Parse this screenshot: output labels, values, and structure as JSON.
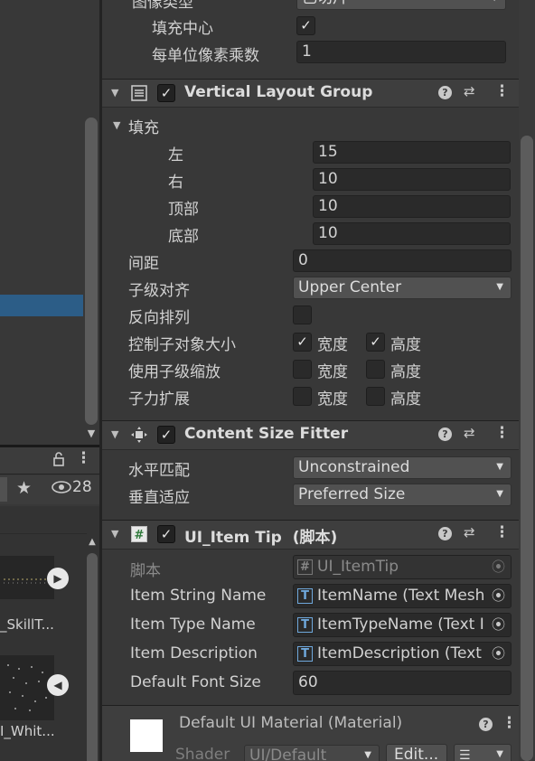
{
  "top_partial": {
    "image_type_label": "图像类型",
    "image_type_value": "已切片"
  },
  "image_section": {
    "fill_center_label": "填充中心",
    "fill_center_checked": true,
    "ppu_label": "每单位像素乘数",
    "ppu_value": "1"
  },
  "vlg": {
    "title": "Vertical Layout Group",
    "padding_label": "填充",
    "left_label": "左",
    "left_value": "15",
    "right_label": "右",
    "right_value": "10",
    "top_label": "顶部",
    "top_value": "10",
    "bottom_label": "底部",
    "bottom_value": "10",
    "spacing_label": "间距",
    "spacing_value": "0",
    "child_align_label": "子级对齐",
    "child_align_value": "Upper Center",
    "reverse_label": "反向排列",
    "control_size_label": "控制子对象大小",
    "use_scale_label": "使用子级缩放",
    "force_expand_label": "子力扩展",
    "width_label": "宽度",
    "height_label": "高度"
  },
  "csf": {
    "title": "Content Size Fitter",
    "horizontal_label": "水平匹配",
    "horizontal_value": "Unconstrained",
    "vertical_label": "垂直适应",
    "vertical_value": "Preferred Size"
  },
  "script": {
    "title": "UI_Item Tip",
    "suffix": "(脚本)",
    "script_label": "脚本",
    "script_value": "UI_ItemTip",
    "string_name_label": "Item String Name",
    "string_name_value": "ItemName (Text Mesh",
    "type_name_label": "Item Type Name",
    "type_name_value": "ItemTypeName (Text I",
    "desc_label": "Item Description",
    "desc_value": "ItemDescription (Text",
    "font_size_label": "Default Font Size",
    "font_size_value": "60"
  },
  "material": {
    "title": "Default UI Material (Material)",
    "shader_label": "Shader",
    "shader_value": "UI/Default",
    "edit_label": "Edit..."
  },
  "left_panel": {
    "eye_count": "28",
    "thumb1_label": "_SkillT...",
    "thumb2_label": "I_Whit..."
  }
}
